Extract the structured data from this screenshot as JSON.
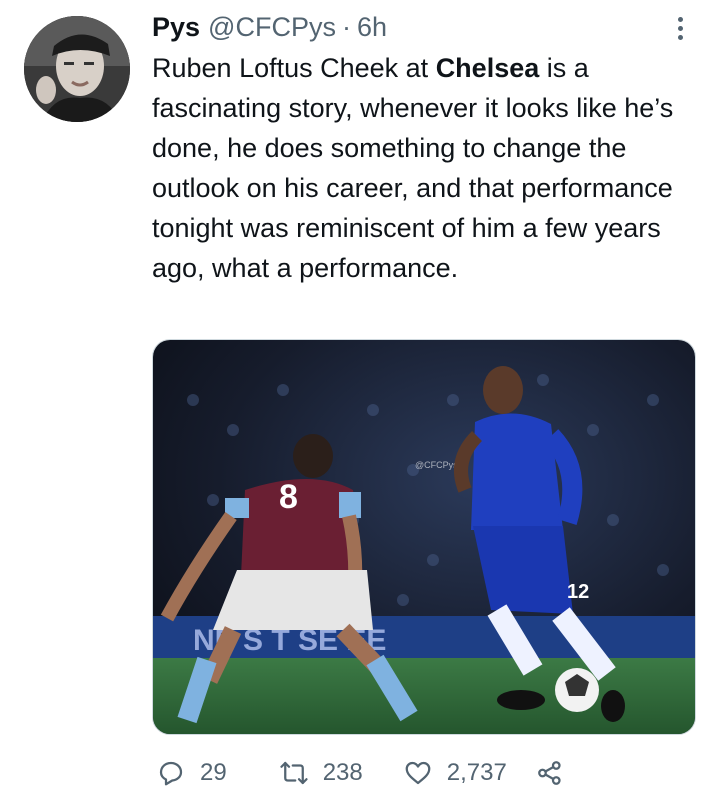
{
  "tweet": {
    "display_name": "Pys",
    "handle": "@CFCPys",
    "separator": "·",
    "time": "6h",
    "text_before": "Ruben Loftus Cheek at ",
    "text_bold": "Chelsea",
    "text_after": " is a fascinating story, whenever it looks like he’s done, he does something to change the outlook on his career, and that performance tonight was reminiscent of him a few years ago, what a performance.",
    "media": {
      "watermark": "@CFCPys",
      "left_player_number": "8",
      "right_player_number": "12"
    },
    "stats": {
      "replies": "29",
      "retweets": "238",
      "likes": "2,737"
    }
  },
  "icons": {
    "more": "more-vertical-icon",
    "reply": "reply-icon",
    "retweet": "retweet-icon",
    "like": "heart-icon",
    "share": "share-icon"
  },
  "colors": {
    "text": "#0f1419",
    "muted": "#536471",
    "chelsea_blue": "#1f3fbf",
    "villa_claret": "#6a1f33",
    "pitch": "#2f6f3c"
  }
}
